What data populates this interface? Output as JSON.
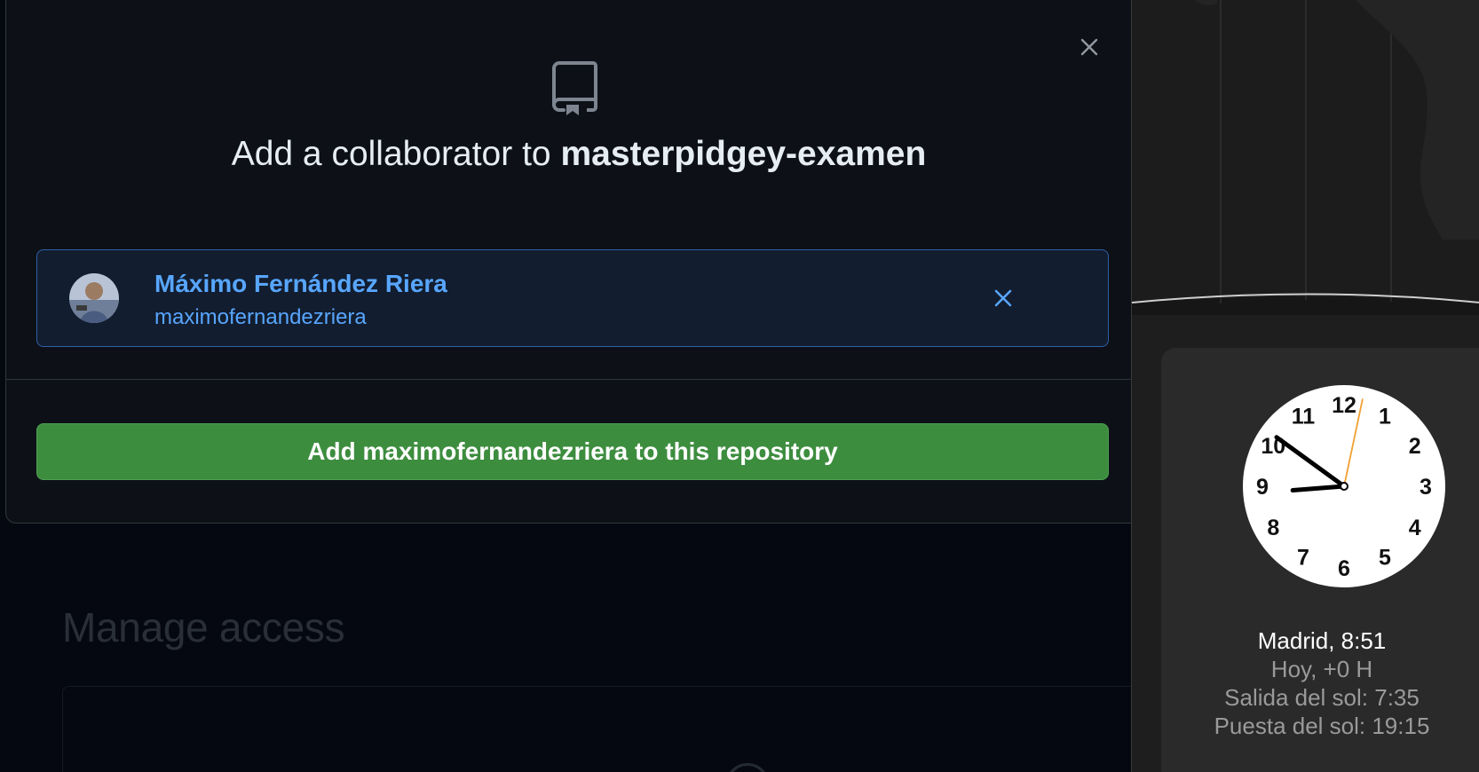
{
  "dialog": {
    "title_prefix": "Add a collaborator to",
    "repo_name": "masterpidgey-examen",
    "user": {
      "name": "Máximo Fernández Riera",
      "login": "maximofernandezriera"
    },
    "add_button": "Add maximofernandezriera to this repository"
  },
  "background": {
    "heading": "Manage access"
  },
  "clock_widget": {
    "city_time": "Madrid, 8:51",
    "today": "Hoy, +0 H",
    "sunrise": "Salida del sol: 7:35",
    "sunset": "Puesta del sol: 19:15",
    "numbers": [
      "12",
      "1",
      "2",
      "3",
      "4",
      "5",
      "6",
      "7",
      "8",
      "9",
      "10",
      "11"
    ]
  },
  "colors": {
    "accent_blue": "#58a6ff",
    "success_green": "#3d8d3f",
    "second_hand": "#f0a030"
  }
}
